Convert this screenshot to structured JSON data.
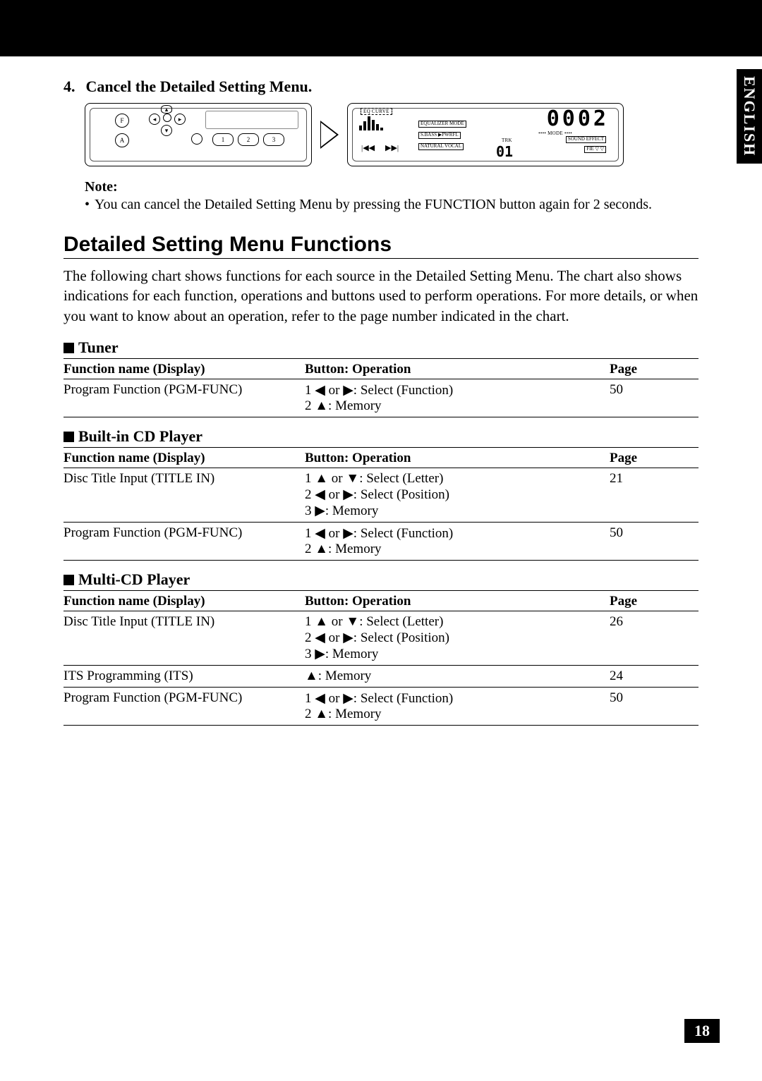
{
  "side_tab": "ENGLISH",
  "step": {
    "num": "4.",
    "text": "Cancel the Detailed Setting Menu."
  },
  "diagram": {
    "left_buttons": {
      "f": "F",
      "a": "A",
      "n1": "1",
      "n2": "2",
      "n3": "3"
    },
    "right": {
      "lcd": "0002",
      "eq_curve": "EQ CURVE",
      "equalizer_mode": "EQUALIZER MODE",
      "sbass": "S.BASS ▶PWRFL",
      "natural_vocal": "NATURAL  VOCAL",
      "mode": "•••• MODE ••••",
      "trk": "TRK",
      "sound_effect": "SOUND EFFECT",
      "fie": "FIE ▽ ▽",
      "prev": "|◀◀",
      "next": "▶▶|",
      "trk_num": "01"
    }
  },
  "note": {
    "head": "Note:",
    "body": "You can cancel the Detailed Setting Menu by pressing the FUNCTION button again for 2 seconds."
  },
  "section_title": "Detailed Setting Menu Functions",
  "intro": "The following chart shows functions for each source in the Detailed Setting Menu. The chart also shows indications for each function, operations and buttons used to perform operations. For more details, or when you want to know about an operation, refer to the page number indicated in the chart.",
  "headers": {
    "c1": "Function name (Display)",
    "c2": "Button: Operation",
    "c3": "Page"
  },
  "tables": [
    {
      "title": "Tuner",
      "rows": [
        {
          "fn": "Program Function (PGM-FUNC)",
          "ops": [
            "1 ◀ or ▶: Select (Function)",
            "2 ▲: Memory"
          ],
          "page": "50"
        }
      ]
    },
    {
      "title": "Built-in CD Player",
      "rows": [
        {
          "fn": "Disc Title Input (TITLE IN)",
          "ops": [
            "1 ▲ or ▼: Select (Letter)",
            "2 ◀ or ▶: Select (Position)",
            "3 ▶: Memory"
          ],
          "page": "21"
        },
        {
          "fn": "Program Function (PGM-FUNC)",
          "ops": [
            "1 ◀ or ▶: Select (Function)",
            "2 ▲: Memory"
          ],
          "page": "50"
        }
      ]
    },
    {
      "title": "Multi-CD Player",
      "rows": [
        {
          "fn": "Disc Title Input (TITLE IN)",
          "ops": [
            "1 ▲ or ▼: Select (Letter)",
            "2 ◀ or ▶: Select (Position)",
            "3 ▶: Memory"
          ],
          "page": "26"
        },
        {
          "fn": "ITS Programming (ITS)",
          "ops": [
            "▲: Memory"
          ],
          "page": "24"
        },
        {
          "fn": "Program Function (PGM-FUNC)",
          "ops": [
            "1 ◀ or ▶: Select (Function)",
            "2 ▲: Memory"
          ],
          "page": "50"
        }
      ]
    }
  ],
  "page_number": "18"
}
